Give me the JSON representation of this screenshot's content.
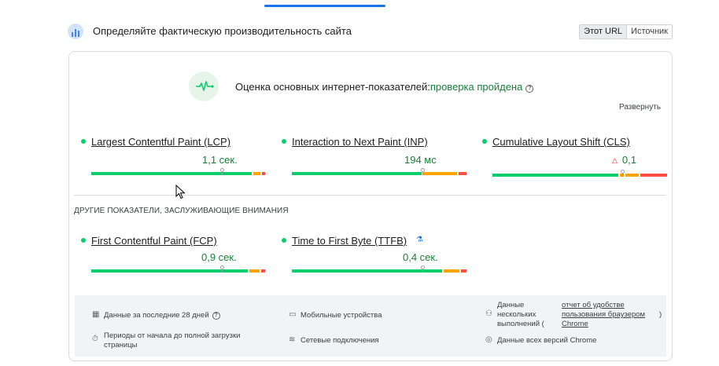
{
  "header": {
    "title": "Определяйте фактическую производительность сайта",
    "toggle": {
      "active": "Этот URL",
      "inactive": "Источник"
    }
  },
  "assessment": {
    "label": "Оценка основных интернет-показателей:",
    "status": "проверка пройдена",
    "help": "?",
    "expand": "Развернуть"
  },
  "metrics": [
    {
      "name": "Largest Contentful Paint (LCP)",
      "value": "1,1 сек."
    },
    {
      "name": "Interaction to Next Paint (INP)",
      "value": "194 мс"
    },
    {
      "name": "Cumulative Layout Shift (CLS)",
      "value": "0,1"
    }
  ],
  "other_label": "ДРУГИЕ ПОКАЗАТЕЛИ, ЗАСЛУЖИВАЮЩИЕ ВНИМАНИЯ",
  "other_metrics": [
    {
      "name": "First Contentful Paint (FCP)",
      "value": "0,9 сек."
    },
    {
      "name": "Time to First Byte (TTFB)",
      "value": "0,4 сек."
    }
  ],
  "footer": {
    "period": "Данные за последние 28 дней",
    "period_help": "?",
    "devices": "Мобильные устройства",
    "samples_line1": "Данные",
    "samples_line2": "нескольких",
    "samples_line3": "выполнений (",
    "report_line1": "отчет об удобстве",
    "report_line2": "пользования браузером",
    "report_line3": "Chrome",
    "paren": ")",
    "load_line1": "Периоды от начала до полной загрузки",
    "load_line2": "страницы",
    "network": "Сетевые подключения",
    "versions": "Данные всех версий Chrome"
  },
  "colors": {
    "good": "#0cce6b",
    "needs_improvement": "#ffa400",
    "poor": "#ff4e42",
    "pass_text": "#188038"
  }
}
